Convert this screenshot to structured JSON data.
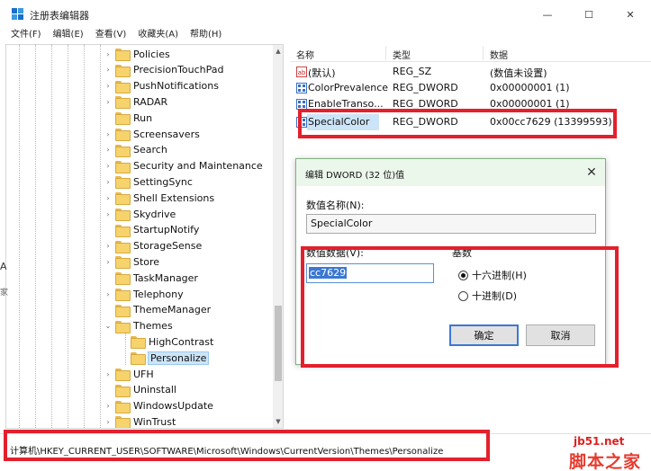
{
  "window": {
    "title": "注册表编辑器",
    "minimize_glyph": "—",
    "maximize_glyph": "☐",
    "close_glyph": "✕"
  },
  "menu": [
    "文件(F)",
    "编辑(E)",
    "查看(V)",
    "收藏夹(A)",
    "帮助(H)"
  ],
  "tree": {
    "items": [
      {
        "label": "Policies",
        "level": 0,
        "expander": "›"
      },
      {
        "label": "PrecisionTouchPad",
        "level": 0,
        "expander": "›"
      },
      {
        "label": "PushNotifications",
        "level": 0,
        "expander": "›"
      },
      {
        "label": "RADAR",
        "level": 0,
        "expander": "›"
      },
      {
        "label": "Run",
        "level": 0,
        "expander": ""
      },
      {
        "label": "Screensavers",
        "level": 0,
        "expander": "›"
      },
      {
        "label": "Search",
        "level": 0,
        "expander": "›"
      },
      {
        "label": "Security and Maintenance",
        "level": 0,
        "expander": "›"
      },
      {
        "label": "SettingSync",
        "level": 0,
        "expander": "›"
      },
      {
        "label": "Shell Extensions",
        "level": 0,
        "expander": "›"
      },
      {
        "label": "Skydrive",
        "level": 0,
        "expander": "›"
      },
      {
        "label": "StartupNotify",
        "level": 0,
        "expander": ""
      },
      {
        "label": "StorageSense",
        "level": 0,
        "expander": "›"
      },
      {
        "label": "Store",
        "level": 0,
        "expander": "›"
      },
      {
        "label": "TaskManager",
        "level": 0,
        "expander": ""
      },
      {
        "label": "Telephony",
        "level": 0,
        "expander": "›"
      },
      {
        "label": "ThemeManager",
        "level": 0,
        "expander": ""
      },
      {
        "label": "Themes",
        "level": 0,
        "expander": "⌄"
      },
      {
        "label": "HighContrast",
        "level": 1,
        "expander": ""
      },
      {
        "label": "Personalize",
        "level": 1,
        "expander": "",
        "selected": true
      },
      {
        "label": "UFH",
        "level": 0,
        "expander": "›"
      },
      {
        "label": "Uninstall",
        "level": 0,
        "expander": ""
      },
      {
        "label": "WindowsUpdate",
        "level": 0,
        "expander": "›"
      },
      {
        "label": "WinTrust",
        "level": 0,
        "expander": "›"
      }
    ]
  },
  "list": {
    "columns": [
      "名称",
      "类型",
      "数据"
    ],
    "rows": [
      {
        "name": "(默认)",
        "type": "REG_SZ",
        "data": "(数值未设置)",
        "icon": "string-value-icon"
      },
      {
        "name": "ColorPrevalence",
        "type": "REG_DWORD",
        "data": "0x00000001 (1)",
        "icon": "dword-value-icon"
      },
      {
        "name": "EnableTranso...",
        "type": "REG_DWORD",
        "data": "0x00000001 (1)",
        "icon": "dword-value-icon"
      },
      {
        "name": "SpecialColor",
        "type": "REG_DWORD",
        "data": "0x00cc7629 (13399593)",
        "icon": "dword-value-icon",
        "selected": true
      }
    ]
  },
  "dialog": {
    "title": "编辑 DWORD (32 位)值",
    "close_glyph": "✕",
    "name_label": "数值名称(N):",
    "name_value": "SpecialColor",
    "data_label": "数值数据(V):",
    "data_value": "cc7629",
    "base_label": "基数",
    "radio_hex": "十六进制(H)",
    "radio_dec": "十进制(D)",
    "ok_label": "确定",
    "cancel_label": "取消"
  },
  "statusbar": {
    "path": "计算机\\HKEY_CURRENT_USER\\SOFTWARE\\Microsoft\\Windows\\CurrentVersion\\Themes\\Personalize"
  },
  "watermark": {
    "url": "jb51.net",
    "name": "脚本之家"
  },
  "edge": {
    "a": "A",
    "b": "家"
  },
  "colors": {
    "annotation_red": "#e3202c",
    "selection_blue": "#cce4f7",
    "dialog_title_bg": "#ecf7ec",
    "folder_yellow": "#f6d36c"
  }
}
